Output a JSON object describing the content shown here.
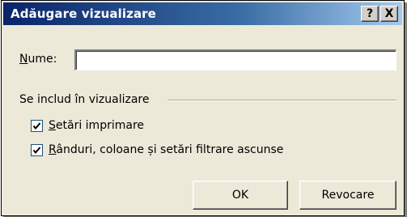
{
  "window": {
    "title": "Adăugare vizualizare",
    "help_button": "?",
    "close_button": "X"
  },
  "name_field": {
    "label_mnemonic": "N",
    "label_rest": "ume:",
    "value": ""
  },
  "include_group": {
    "label": "Se includ în vizualizare",
    "options": [
      {
        "mnemonic": "S",
        "label_rest": "etări imprimare",
        "checked": true
      },
      {
        "mnemonic": "R",
        "label_rest": "ânduri, coloane și setări filtrare ascunse",
        "checked": true
      }
    ]
  },
  "buttons": {
    "ok": "OK",
    "cancel": "Revocare"
  },
  "colors": {
    "title_bar_start": "#0a246a",
    "title_bar_end": "#a6caf0",
    "dialog_background": "#ece9d8"
  }
}
